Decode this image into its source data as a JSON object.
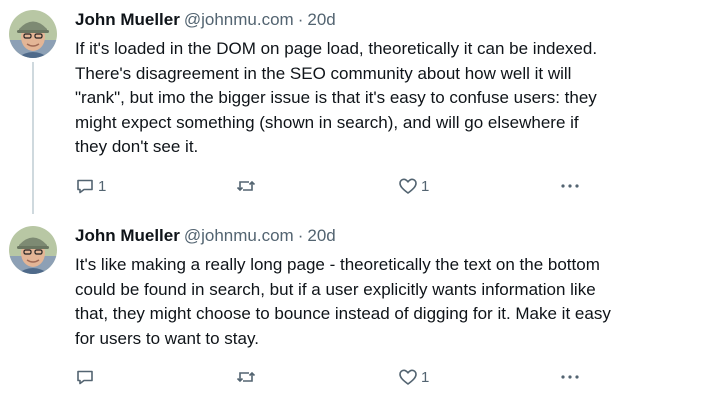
{
  "tweets": [
    {
      "author": "John Mueller",
      "handle": "@johnmu.com",
      "separator": "·",
      "time": "20d",
      "text": "If it's loaded in the DOM on page load, theoretically it can be indexed.\nThere's disagreement in the SEO community about how well it will\n\"rank\", but imo the bigger issue is that it's easy to confuse users: they\nmight expect something (shown in search), and will go elsewhere if\nthey don't see it.",
      "reply_count": "1",
      "repost_count": "",
      "like_count": "1"
    },
    {
      "author": "John Mueller",
      "handle": "@johnmu.com",
      "separator": "·",
      "time": "20d",
      "text": "It's like making a really long page - theoretically the text on the bottom\ncould be found in search, but if a user explicitly wants information like\nthat, they might choose to bounce instead of digging for it. Make it easy\nfor users to want to stay.",
      "reply_count": "",
      "repost_count": "",
      "like_count": "1"
    }
  ],
  "icons": {
    "reply": "reply-icon",
    "repost": "repost-icon",
    "like": "heart-icon",
    "more": "more-icon"
  },
  "colors": {
    "text": "#0f1419",
    "muted": "#536471",
    "thread_line": "#cfd9de"
  }
}
